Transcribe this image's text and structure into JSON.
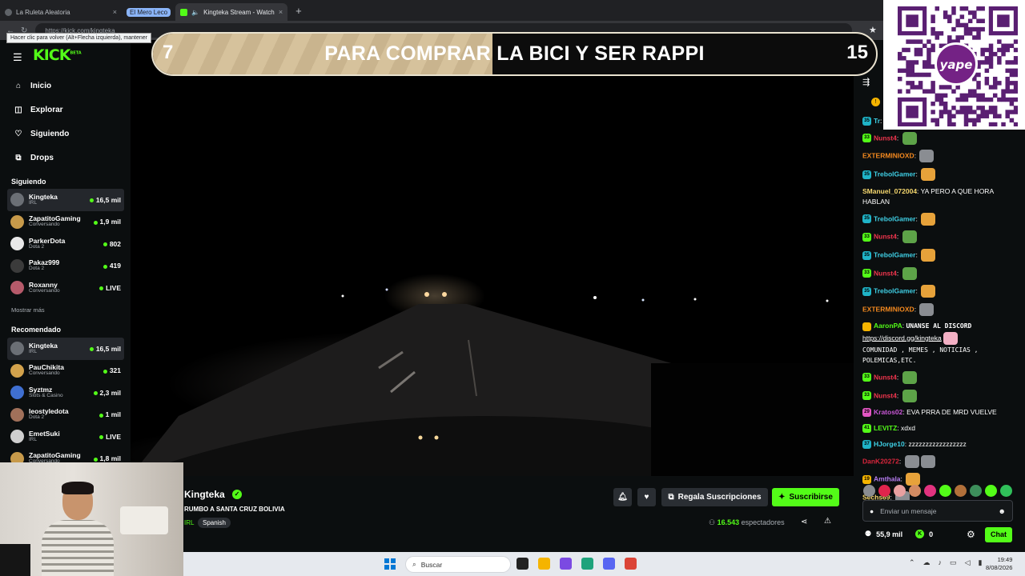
{
  "browser": {
    "tabs": [
      {
        "title": "La Ruleta Aleatoria",
        "close": "×"
      },
      {
        "title": "El Mero Leco"
      },
      {
        "title": "Kingteka Stream - Watch Live",
        "close": "×"
      }
    ],
    "new_tab": "+",
    "url": "https://kick.com/kingteka",
    "tooltip": "Hacer clic para volver (Alt+Flecha izquierda), mantener"
  },
  "kick": {
    "logo": "KICK",
    "logo_sup": "BETA",
    "nav": [
      {
        "label": "Inicio",
        "icon": "home-icon"
      },
      {
        "label": "Explorar",
        "icon": "compass-icon"
      },
      {
        "label": "Siguiendo",
        "icon": "heart-icon"
      },
      {
        "label": "Drops",
        "icon": "gift-icon"
      }
    ],
    "following_title": "Siguiendo",
    "following": [
      {
        "name": "Kingteka",
        "category": "IRL",
        "viewers": "16,5 mil"
      },
      {
        "name": "ZapatitoGaming",
        "category": "Conversando",
        "viewers": "1,9 mil"
      },
      {
        "name": "ParkerDota",
        "category": "Dota 2",
        "viewers": "802"
      },
      {
        "name": "Pakaz999",
        "category": "Dota 2",
        "viewers": "419"
      },
      {
        "name": "Roxanny",
        "category": "Conversando",
        "viewers": "LIVE"
      }
    ],
    "show_more": "Mostrar más",
    "recommended_title": "Recomendado",
    "recommended": [
      {
        "name": "Kingteka",
        "category": "IRL",
        "viewers": "16,5 mil"
      },
      {
        "name": "PauChikita",
        "category": "Conversando",
        "viewers": "321"
      },
      {
        "name": "Syztmz",
        "category": "Slots & Casino",
        "viewers": "2,3 mil"
      },
      {
        "name": "leostyledota",
        "category": "Dota 2",
        "viewers": "1 mil"
      },
      {
        "name": "EmetSuki",
        "category": "IRL",
        "viewers": "LIVE"
      },
      {
        "name": "ZapatitoGaming",
        "category": "Conversando",
        "viewers": "1,8 mil"
      }
    ]
  },
  "goal_banner": {
    "current": "7",
    "text": "PARA COMPRAR LA BICI Y SER RAPPI",
    "target": "15",
    "progress_fraction": 0.47
  },
  "qr": {
    "brand": "yape"
  },
  "stream": {
    "streamer": "Kingteka",
    "title": "RUMBO A SANTA CRUZ BOLIVIA",
    "category": "IRL",
    "language": "Spanish",
    "gift_button": "Regala Suscripciones",
    "subscribe_button": "Suscribirse",
    "viewers": "16.543",
    "viewers_label": "espectadores"
  },
  "chat": {
    "messages": [
      {
        "badge": "35",
        "user": "Tr",
        "color": "#3fd0e6",
        "text": "",
        "emote": ""
      },
      {
        "badge": "33",
        "user": "Nunst4",
        "color": "#f0354d",
        "text": "",
        "emote": "frog"
      },
      {
        "badge": "",
        "user": "EXTERMINIOXD",
        "color": "#f58a1f",
        "text": "",
        "emote": "cat"
      },
      {
        "badge": "35",
        "user": "TrebolGamer",
        "color": "#3fd0e6",
        "text": "",
        "emote": "fire"
      },
      {
        "badge": "",
        "user": "SManuel_072004",
        "color": "#f5d76e",
        "text": "YA PERO A QUE HORA HABLAN",
        "emote": ""
      },
      {
        "badge": "35",
        "user": "TrebolGamer",
        "color": "#3fd0e6",
        "text": "",
        "emote": "fire"
      },
      {
        "badge": "33",
        "user": "Nunst4",
        "color": "#f0354d",
        "text": "",
        "emote": "frog"
      },
      {
        "badge": "35",
        "user": "TrebolGamer",
        "color": "#3fd0e6",
        "text": "",
        "emote": "fire"
      },
      {
        "badge": "33",
        "user": "Nunst4",
        "color": "#f0354d",
        "text": "",
        "emote": "frog"
      },
      {
        "badge": "35",
        "user": "TrebolGamer",
        "color": "#3fd0e6",
        "text": "",
        "emote": "fire"
      },
      {
        "badge": "",
        "user": "EXTERMINIOXD",
        "color": "#f58a1f",
        "text": "",
        "emote": "cat"
      }
    ],
    "aaron": {
      "user": "AaronPA",
      "text": "UNANSE AL DISCORD",
      "link": "https://discord.gg/kingteka",
      "extra": "COMUNIDAD , MEMES , NOTICIAS , POLEMICAS,ETC."
    },
    "messages2": [
      {
        "badge": "33",
        "user": "Nunst4",
        "color": "#f0354d",
        "text": "",
        "emote": "frog"
      },
      {
        "badge": "33",
        "user": "Nunst4",
        "color": "#f0354d",
        "text": "",
        "emote": "frog"
      },
      {
        "badge": "29",
        "user": "Kratos02",
        "color": "#c957d6",
        "text": "EVA PRRA DE MRD VUELVE",
        "emote": ""
      },
      {
        "badge": "41",
        "user": "LEVITZ",
        "color": "#53fc18",
        "text": "xdxd",
        "emote": ""
      },
      {
        "badge": "37",
        "user": "HJorge10",
        "color": "#3fd0e6",
        "text": "zzzzzzzzzzzzzzzzz",
        "emote": ""
      },
      {
        "badge": "",
        "user": "DanK20272",
        "color": "#d8263c",
        "text": "",
        "emote": "cat2"
      },
      {
        "badge": "19",
        "user": "Amthala",
        "color": "#b57cf0",
        "text": "",
        "emote": "fire"
      },
      {
        "badge": "",
        "user": "Sechs69",
        "color": "#f5d76e",
        "text": "",
        "emote": "cat"
      }
    ],
    "input_placeholder": "Enviar un mensaje",
    "followers": "55,9 mil",
    "coins": "0",
    "chat_button": "Chat"
  },
  "taskbar": {
    "search_placeholder": "Buscar",
    "time": "19:49",
    "date": "8/08/2026"
  }
}
